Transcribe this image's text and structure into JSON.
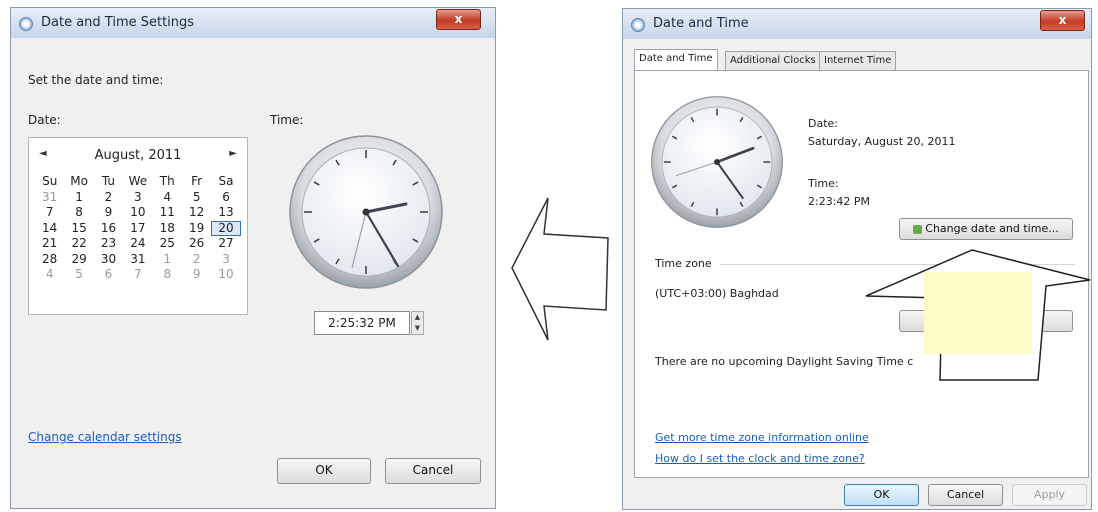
{
  "left_window": {
    "title": "Date and Time Settings",
    "close": "x",
    "heading": "Set the date and time:",
    "date_label": "Date:",
    "time_label": "Time:",
    "calendar": {
      "prev": "◄",
      "next": "►",
      "month": "August, 2011",
      "weekdays": [
        "Su",
        "Mo",
        "Tu",
        "We",
        "Th",
        "Fr",
        "Sa"
      ],
      "weeks": [
        [
          "31",
          "1",
          "2",
          "3",
          "4",
          "5",
          "6"
        ],
        [
          "7",
          "8",
          "9",
          "10",
          "11",
          "12",
          "13"
        ],
        [
          "14",
          "15",
          "16",
          "17",
          "18",
          "19",
          "20"
        ],
        [
          "21",
          "22",
          "23",
          "24",
          "25",
          "26",
          "27"
        ],
        [
          "28",
          "29",
          "30",
          "31",
          "1",
          "2",
          "3"
        ],
        [
          "4",
          "5",
          "6",
          "7",
          "8",
          "9",
          "10"
        ]
      ],
      "selected": "20"
    },
    "time_value": "2:25:32 PM",
    "spinner_up": "▲",
    "spinner_down": "▼",
    "link": "Change calendar settings",
    "ok": "OK",
    "cancel": "Cancel"
  },
  "right_window": {
    "title": "Date and Time",
    "close": "x",
    "tabs": [
      "Date and Time",
      "Additional Clocks",
      "Internet Time"
    ],
    "date_label": "Date:",
    "date_value": "Saturday, August 20, 2011",
    "time_label": "Time:",
    "time_value": "2:23:42 PM",
    "change_button": "Change date and time...",
    "timezone_label": "Time zone",
    "timezone_value": "(UTC+03:00) Baghdad",
    "dst_text": "There are no upcoming Daylight Saving Time c",
    "link1": "Get more time zone information online",
    "link2": "How do I set the clock and time zone?",
    "ok": "OK",
    "cancel": "Cancel",
    "apply": "Apply"
  },
  "colors": {
    "link": "#1a5fb4",
    "highlight": "#fffbc7",
    "close": "#c43b27"
  }
}
